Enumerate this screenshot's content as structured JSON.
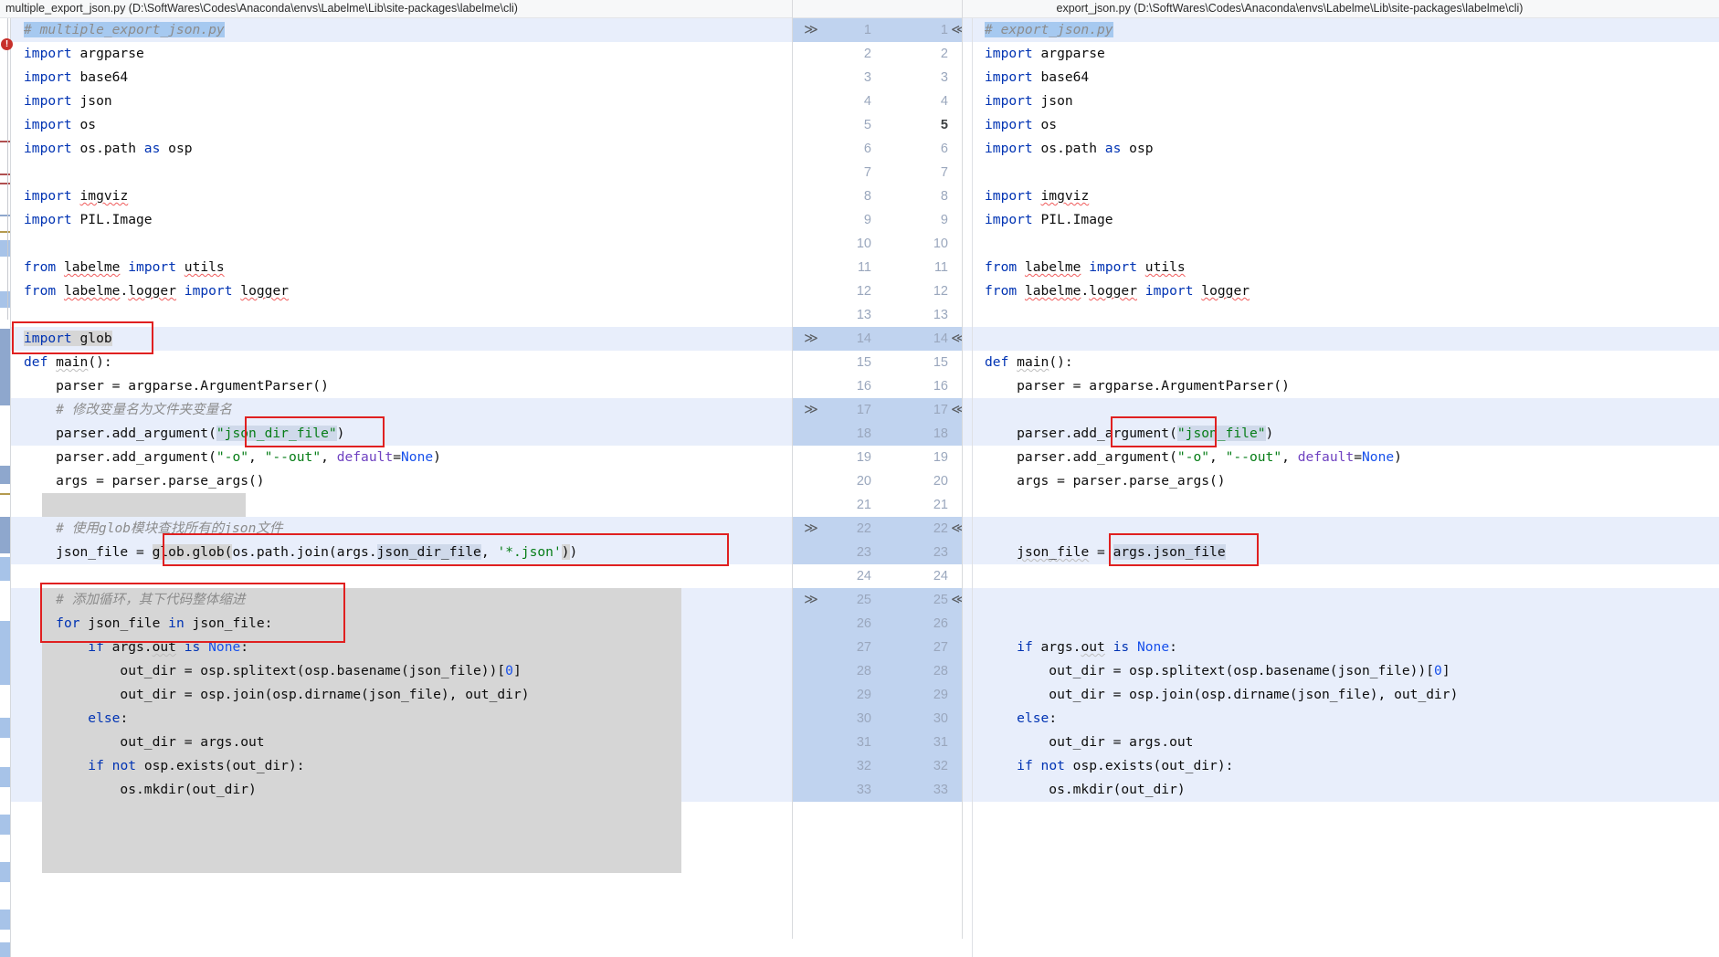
{
  "titlebar": {
    "left_file": "multiple_export_json.py (D:\\SoftWares\\Codes\\Anaconda\\envs\\Labelme\\Lib\\site-packages\\labelme\\cli)",
    "right_file": "export_json.py (D:\\SoftWares\\Codes\\Anaconda\\envs\\Labelme\\Lib\\site-packages\\labelme\\cli)"
  },
  "icons": {
    "chevron_right": "≫",
    "chevron_left": "≪",
    "error_badge": "!"
  },
  "colors": {
    "accent_selection": "#a6c9f0",
    "diff_row": "#e8eefb",
    "diff_row_strong": "#dfe7f6",
    "gutter_diff": "#c6d8f2",
    "inline_change": "#cfd9ea",
    "inline_grey": "#d6d6d6",
    "annotation_red": "#e02020",
    "keyword_blue": "#0033b3",
    "string_green": "#067d17",
    "comment_grey": "#8c8c8c",
    "param_purple": "#6f42c1",
    "number_blue": "#1750eb"
  },
  "gutter": {
    "rows": [
      {
        "left": "1",
        "right": "1",
        "diff": true,
        "chev_l": true,
        "chev_r": true,
        "current": false
      },
      {
        "left": "2",
        "right": "2",
        "diff": false,
        "chev_l": false,
        "chev_r": false,
        "current": false
      },
      {
        "left": "3",
        "right": "3",
        "diff": false,
        "chev_l": false,
        "chev_r": false,
        "current": false
      },
      {
        "left": "4",
        "right": "4",
        "diff": false,
        "chev_l": false,
        "chev_r": false,
        "current": false
      },
      {
        "left": "5",
        "right": "5",
        "diff": false,
        "chev_l": false,
        "chev_r": false,
        "current": true
      },
      {
        "left": "6",
        "right": "6",
        "diff": false,
        "chev_l": false,
        "chev_r": false,
        "current": false
      },
      {
        "left": "7",
        "right": "7",
        "diff": false,
        "chev_l": false,
        "chev_r": false,
        "current": false
      },
      {
        "left": "8",
        "right": "8",
        "diff": false,
        "chev_l": false,
        "chev_r": false,
        "current": false
      },
      {
        "left": "9",
        "right": "9",
        "diff": false,
        "chev_l": false,
        "chev_r": false,
        "current": false
      },
      {
        "left": "10",
        "right": "10",
        "diff": false,
        "chev_l": false,
        "chev_r": false,
        "current": false
      },
      {
        "left": "11",
        "right": "11",
        "diff": false,
        "chev_l": false,
        "chev_r": false,
        "current": false
      },
      {
        "left": "12",
        "right": "12",
        "diff": false,
        "chev_l": false,
        "chev_r": false,
        "current": false
      },
      {
        "left": "13",
        "right": "13",
        "diff": false,
        "chev_l": false,
        "chev_r": false,
        "current": false
      },
      {
        "left": "14",
        "right": "14",
        "diff": true,
        "chev_l": true,
        "chev_r": true,
        "current": false
      },
      {
        "left": "15",
        "right": "15",
        "diff": false,
        "chev_l": false,
        "chev_r": false,
        "current": false
      },
      {
        "left": "16",
        "right": "16",
        "diff": false,
        "chev_l": false,
        "chev_r": false,
        "current": false
      },
      {
        "left": "17",
        "right": "17",
        "diff": true,
        "chev_l": true,
        "chev_r": true,
        "current": false
      },
      {
        "left": "18",
        "right": "18",
        "diff": true,
        "chev_l": false,
        "chev_r": false,
        "current": false
      },
      {
        "left": "19",
        "right": "19",
        "diff": false,
        "chev_l": false,
        "chev_r": false,
        "current": false
      },
      {
        "left": "20",
        "right": "20",
        "diff": false,
        "chev_l": false,
        "chev_r": false,
        "current": false
      },
      {
        "left": "21",
        "right": "21",
        "diff": false,
        "chev_l": false,
        "chev_r": false,
        "current": false
      },
      {
        "left": "22",
        "right": "22",
        "diff": true,
        "chev_l": true,
        "chev_r": true,
        "current": false
      },
      {
        "left": "23",
        "right": "23",
        "diff": true,
        "chev_l": false,
        "chev_r": false,
        "current": false
      },
      {
        "left": "24",
        "right": "24",
        "diff": false,
        "chev_l": false,
        "chev_r": false,
        "current": false
      },
      {
        "left": "25",
        "right": "25",
        "diff": true,
        "chev_l": true,
        "chev_r": true,
        "current": false
      },
      {
        "left": "26",
        "right": "26",
        "diff": true,
        "chev_l": false,
        "chev_r": false,
        "current": false
      },
      {
        "left": "27",
        "right": "27",
        "diff": true,
        "chev_l": false,
        "chev_r": false,
        "current": false
      },
      {
        "left": "28",
        "right": "28",
        "diff": true,
        "chev_l": false,
        "chev_r": false,
        "current": false
      },
      {
        "left": "29",
        "right": "29",
        "diff": true,
        "chev_l": false,
        "chev_r": false,
        "current": false
      },
      {
        "left": "30",
        "right": "30",
        "diff": true,
        "chev_l": false,
        "chev_r": false,
        "current": false
      },
      {
        "left": "31",
        "right": "31",
        "diff": true,
        "chev_l": false,
        "chev_r": false,
        "current": false
      },
      {
        "left": "32",
        "right": "32",
        "diff": true,
        "chev_l": false,
        "chev_r": false,
        "current": false
      },
      {
        "left": "33",
        "right": "33",
        "diff": true,
        "chev_l": false,
        "chev_r": false,
        "current": false
      }
    ]
  },
  "left_pane": {
    "lines": [
      "# multiple_export_json.py",
      "import argparse",
      "import base64",
      "import json",
      "import os",
      "import os.path as osp",
      "",
      "import imgviz",
      "import PIL.Image",
      "",
      "from labelme import utils",
      "from labelme.logger import logger",
      "",
      "import glob",
      "def main():",
      "    parser = argparse.ArgumentParser()",
      "    # 修改变量名为文件夹变量名",
      "    parser.add_argument(\"json_dir_file\")",
      "    parser.add_argument(\"-o\", \"--out\", default=None)",
      "    args = parser.parse_args()",
      "",
      "    # 使用glob模块查找所有的json文件",
      "    json_file = glob.glob(os.path.join(args.json_dir_file, '*.json'))",
      "",
      "    # 添加循环，其下代码整体缩进",
      "    for json_file in json_file:",
      "        if args.out is None:",
      "            out_dir = osp.splitext(osp.basename(json_file))[0]",
      "            out_dir = osp.join(osp.dirname(json_file), out_dir)",
      "        else:",
      "            out_dir = args.out",
      "        if not osp.exists(out_dir):",
      "            os.mkdir(out_dir)"
    ]
  },
  "right_pane": {
    "lines": [
      "# export_json.py",
      "import argparse",
      "import base64",
      "import json",
      "import os",
      "import os.path as osp",
      "",
      "import imgviz",
      "import PIL.Image",
      "",
      "from labelme import utils",
      "from labelme.logger import logger",
      "",
      "",
      "def main():",
      "    parser = argparse.ArgumentParser()",
      "",
      "    parser.add_argument(\"json_file\")",
      "    parser.add_argument(\"-o\", \"--out\", default=None)",
      "    args = parser.parse_args()",
      "",
      "",
      "    json_file = args.json_file",
      "",
      "",
      "",
      "    if args.out is None:",
      "        out_dir = osp.splitext(osp.basename(json_file))[0]",
      "        out_dir = osp.join(osp.dirname(json_file), out_dir)",
      "    else:",
      "        out_dir = args.out",
      "    if not osp.exists(out_dir):",
      "        os.mkdir(out_dir)"
    ]
  },
  "annotations": {
    "boxes": [
      {
        "name": "import-glob-box",
        "label": "import glob"
      },
      {
        "name": "json-dir-file-box-left",
        "label": "\"json_dir_file\""
      },
      {
        "name": "glob-glob-box-left",
        "label": "glob.glob(os.path.join(args.json_dir_file, '*.json'))"
      },
      {
        "name": "for-loop-box-left",
        "label": "# 添加循环，其下代码整体缩进 / for json_file in json_file:"
      },
      {
        "name": "json-file-box-right",
        "label": "\"json_file\""
      },
      {
        "name": "args-json-file-box-right",
        "label": "args.json_file"
      }
    ]
  }
}
